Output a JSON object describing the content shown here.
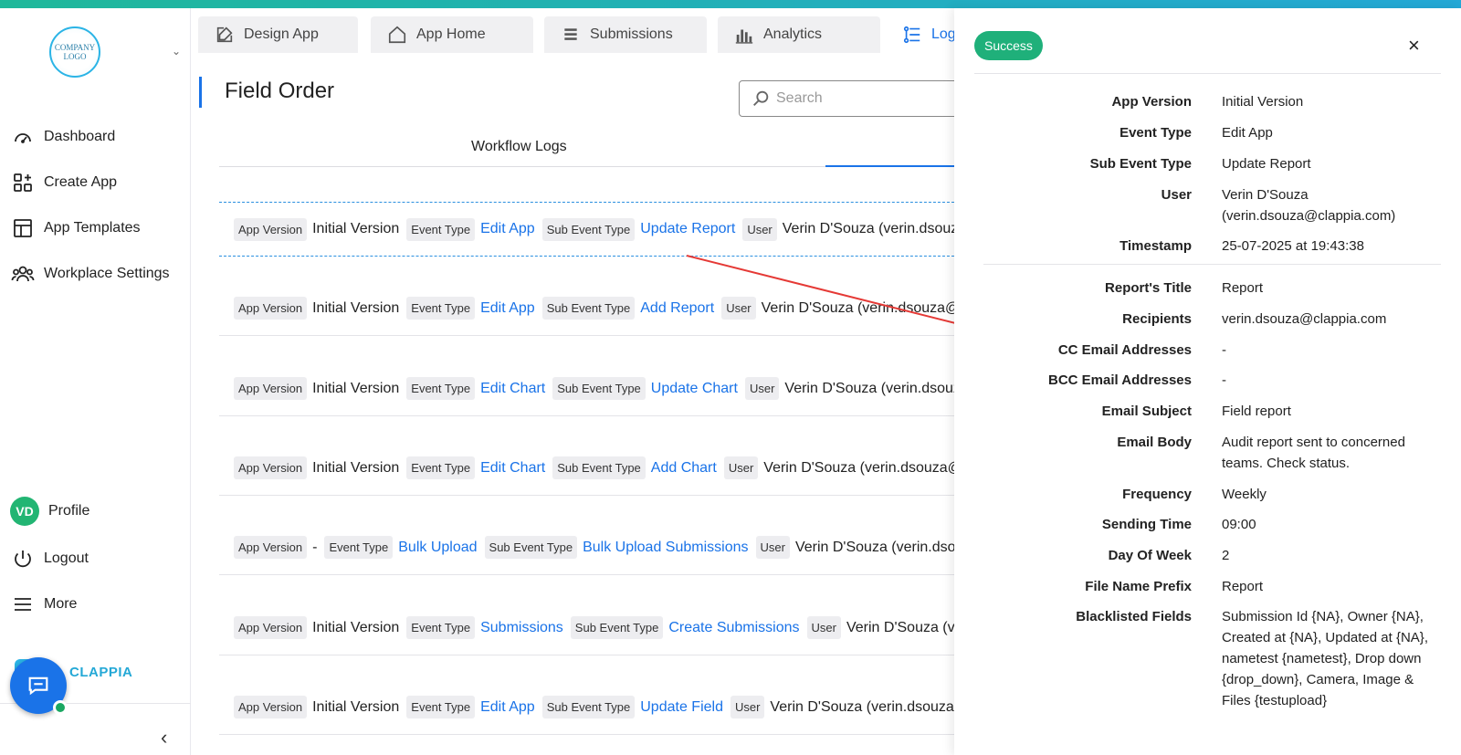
{
  "sidebar": {
    "logo_text": "COMPANY LOGO",
    "nav": [
      {
        "label": "Dashboard"
      },
      {
        "label": "Create App"
      },
      {
        "label": "App Templates"
      },
      {
        "label": "Workplace Settings"
      }
    ],
    "profile_initials": "VD",
    "profile_label": "Profile",
    "logout_label": "Logout",
    "more_label": "More",
    "brand_text": "CLAPPIA"
  },
  "tabs": [
    {
      "label": "Design App",
      "icon": "edit-icon"
    },
    {
      "label": "App Home",
      "icon": "home-icon"
    },
    {
      "label": "Submissions",
      "icon": "list-icon"
    },
    {
      "label": "Analytics",
      "icon": "bar-chart-icon"
    },
    {
      "label": "Log",
      "icon": "logs-icon"
    }
  ],
  "main": {
    "title": "Field Order",
    "search_placeholder": "Search",
    "subtab": "Workflow Logs"
  },
  "chip_labels": {
    "app_version": "App Version",
    "event_type": "Event Type",
    "sub_event_type": "Sub Event Type",
    "user": "User"
  },
  "logs": [
    {
      "app_version": "Initial Version",
      "event_type": "Edit App",
      "sub_event_type": "Update Report",
      "user": "Verin D'Souza (verin.dsouza"
    },
    {
      "app_version": "Initial Version",
      "event_type": "Edit App",
      "sub_event_type": "Add Report",
      "user": "Verin D'Souza (verin.dsouza@c"
    },
    {
      "app_version": "Initial Version",
      "event_type": "Edit Chart",
      "sub_event_type": "Update Chart",
      "user": "Verin D'Souza (verin.dsouza"
    },
    {
      "app_version": "Initial Version",
      "event_type": "Edit Chart",
      "sub_event_type": "Add Chart",
      "user": "Verin D'Souza (verin.dsouza@c"
    },
    {
      "app_version": "-",
      "event_type": "Bulk Upload",
      "sub_event_type": "Bulk Upload Submissions",
      "user": "Verin D'Souza (verin.dsou"
    },
    {
      "app_version": "Initial Version",
      "event_type": "Submissions",
      "sub_event_type": "Create Submissions",
      "user": "Verin D'Souza (ver"
    },
    {
      "app_version": "Initial Version",
      "event_type": "Edit App",
      "sub_event_type": "Update Field",
      "user": "Verin D'Souza (verin.dsouza@"
    }
  ],
  "detail": {
    "status": "Success",
    "close_glyph": "×",
    "fields": [
      {
        "label": "App Version",
        "value": "Initial Version"
      },
      {
        "label": "Event Type",
        "value": "Edit App"
      },
      {
        "label": "Sub Event Type",
        "value": "Update Report"
      },
      {
        "label": "User",
        "value": "Verin D'Souza (verin.dsouza@clappia.com)"
      },
      {
        "label": "Timestamp",
        "value": "25-07-2025 at 19:43:38"
      },
      {
        "label": "Report's Title",
        "value": "Report"
      },
      {
        "label": "Recipients",
        "value": "verin.dsouza@clappia.com"
      },
      {
        "label": "CC Email Addresses",
        "value": "-"
      },
      {
        "label": "BCC Email Addresses",
        "value": "-"
      },
      {
        "label": "Email Subject",
        "value": "Field report"
      },
      {
        "label": "Email Body",
        "value": "Audit report sent to concerned teams. Check status."
      },
      {
        "label": "Frequency",
        "value": "Weekly"
      },
      {
        "label": "Sending Time",
        "value": "09:00"
      },
      {
        "label": "Day Of Week",
        "value": "2"
      },
      {
        "label": "File Name Prefix",
        "value": "Report"
      },
      {
        "label": "Blacklisted Fields",
        "value": "Submission Id {NA}, Owner {NA}, Created at {NA}, Updated at {NA}, nametest {nametest}, Drop down {drop_down}, Camera, Image & Files {testupload}"
      }
    ]
  },
  "colors": {
    "accent": "#1a73e8",
    "success": "#1fb07a",
    "annotation_arrow": "#e53935"
  }
}
